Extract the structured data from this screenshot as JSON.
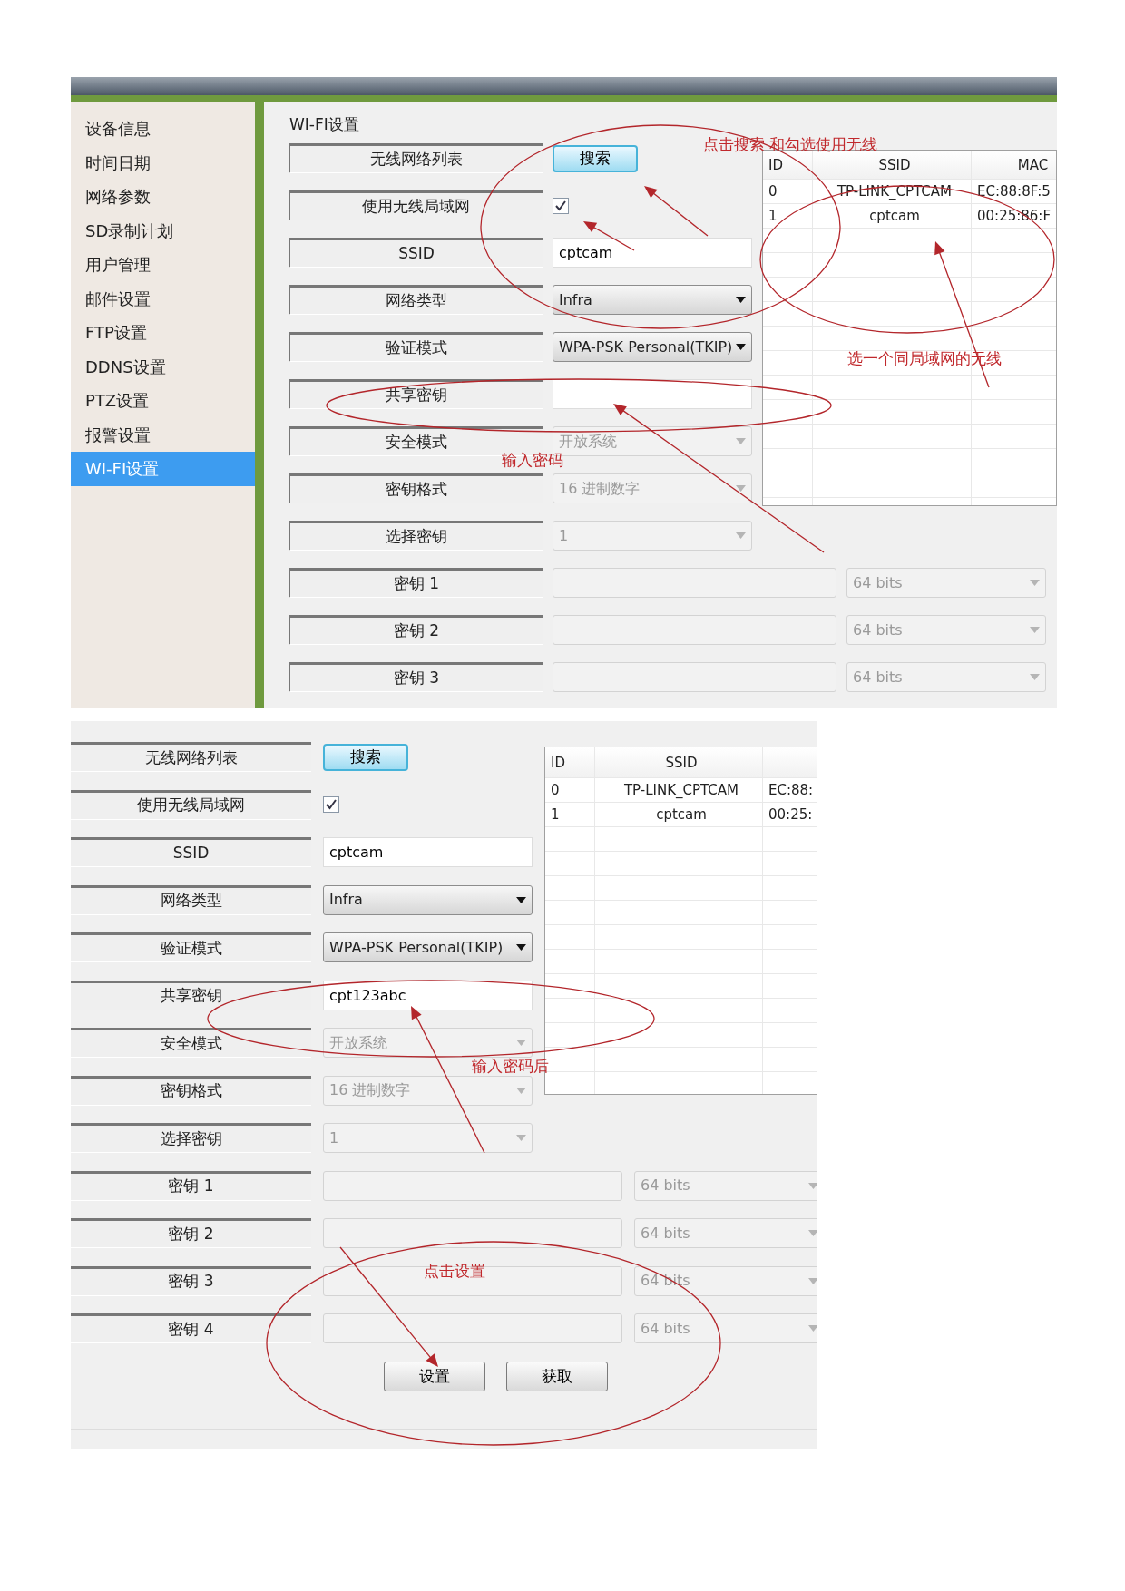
{
  "screenshots": [
    {
      "sidebar": {
        "items": [
          {
            "label": "设备信息",
            "selected": false
          },
          {
            "label": "时间日期",
            "selected": false
          },
          {
            "label": "网络参数",
            "selected": false
          },
          {
            "label": "SD录制计划",
            "selected": false
          },
          {
            "label": "用户管理",
            "selected": false
          },
          {
            "label": "邮件设置",
            "selected": false
          },
          {
            "label": "FTP设置",
            "selected": false
          },
          {
            "label": "DDNS设置",
            "selected": false
          },
          {
            "label": "PTZ设置",
            "selected": false
          },
          {
            "label": "报警设置",
            "selected": false
          },
          {
            "label": "WI-FI设置",
            "selected": true
          }
        ]
      },
      "group_title": "WI-FI设置",
      "form": [
        {
          "label": "无线网络列表",
          "kind": "button",
          "value": "搜索"
        },
        {
          "label": "使用无线局域网",
          "kind": "checkbox",
          "checked": true
        },
        {
          "label": "SSID",
          "kind": "text",
          "value": "cptcam"
        },
        {
          "label": "网络类型",
          "kind": "select",
          "value": "Infra",
          "disabled": false
        },
        {
          "label": "验证模式",
          "kind": "select",
          "value": "WPA-PSK Personal(TKIP)",
          "disabled": false
        },
        {
          "label": "共享密钥",
          "kind": "text"
        },
        {
          "label": "安全模式",
          "kind": "select",
          "value": "开放系统",
          "disabled": true
        },
        {
          "label": "密钥格式",
          "kind": "select",
          "value": "16 进制数字",
          "disabled": true
        },
        {
          "label": "选择密钥",
          "kind": "select",
          "value": "1",
          "disabled": true
        },
        {
          "label": "密钥 1",
          "kind": "key",
          "size": "64 bits",
          "disabled": true
        },
        {
          "label": "密钥 2",
          "kind": "key",
          "size": "64 bits",
          "disabled": true
        },
        {
          "label": "密钥 3",
          "kind": "key",
          "size": "64 bits",
          "disabled": true
        }
      ],
      "network_table": {
        "columns": [
          "ID",
          "SSID",
          "MAC"
        ],
        "rows": [
          [
            "0",
            "TP-LINK_CPTCAM",
            "EC:88:8F:5"
          ],
          [
            "1",
            "cptcam",
            "00:25:86:F"
          ]
        ]
      },
      "annotations": [
        "点击搜索 和勾选使用无线",
        "选一个同局域网的无线",
        "输入密码"
      ]
    },
    {
      "form": [
        {
          "label": "无线网络列表",
          "kind": "button",
          "value": "搜索"
        },
        {
          "label": "使用无线局域网",
          "kind": "checkbox",
          "checked": true
        },
        {
          "label": "SSID",
          "kind": "text",
          "value": "cptcam"
        },
        {
          "label": "网络类型",
          "kind": "select",
          "value": "Infra",
          "disabled": false
        },
        {
          "label": "验证模式",
          "kind": "select",
          "value": "WPA-PSK Personal(TKIP)",
          "disabled": false
        },
        {
          "label": "共享密钥",
          "kind": "text",
          "value": "cpt123abc"
        },
        {
          "label": "安全模式",
          "kind": "select",
          "value": "开放系统",
          "disabled": true
        },
        {
          "label": "密钥格式",
          "kind": "select",
          "value": "16 进制数字",
          "disabled": true
        },
        {
          "label": "选择密钥",
          "kind": "select",
          "value": "1",
          "disabled": true
        },
        {
          "label": "密钥 1",
          "kind": "key",
          "size": "64 bits",
          "disabled": true
        },
        {
          "label": "密钥 2",
          "kind": "key",
          "size": "64 bits",
          "disabled": true
        },
        {
          "label": "密钥 3",
          "kind": "key",
          "size": "64 bits",
          "disabled": true
        },
        {
          "label": "密钥 4",
          "kind": "key",
          "size": "64 bits",
          "disabled": true
        }
      ],
      "network_table": {
        "columns": [
          "ID",
          "SSID"
        ],
        "rows": [
          [
            "0",
            "TP-LINK_CPTCAM",
            "EC:88:"
          ],
          [
            "1",
            "cptcam",
            "00:25:"
          ]
        ]
      },
      "buttons": [
        "设置",
        "获取"
      ],
      "annotations": [
        "输入密码后",
        "点击设置"
      ]
    }
  ]
}
